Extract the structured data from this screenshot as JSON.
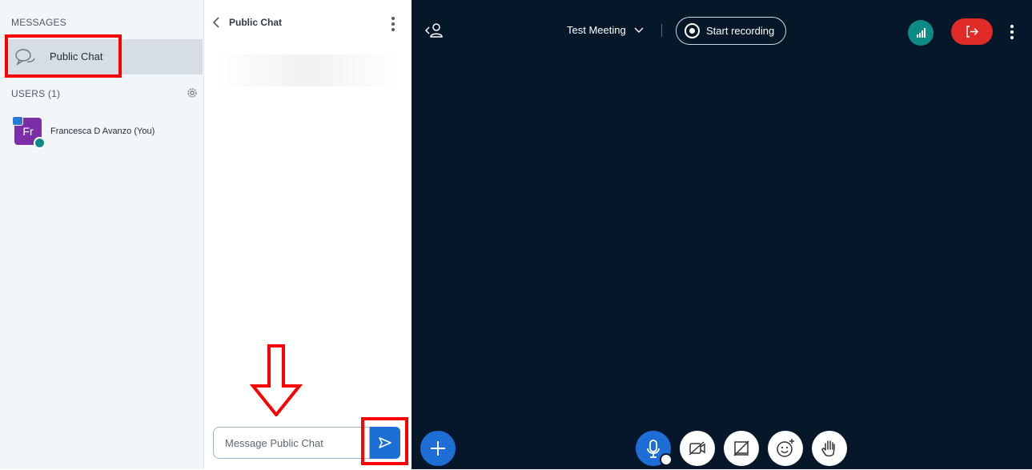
{
  "sidebar": {
    "messages_title": "MESSAGES",
    "public_chat_label": "Public Chat",
    "users_title": "USERS (1)",
    "users": [
      {
        "initials": "Fr",
        "name": "Francesca D Avanzo (You)"
      }
    ]
  },
  "chat": {
    "title": "Public Chat",
    "input_placeholder": "Message Public Chat"
  },
  "top_bar": {
    "meeting_title": "Test Meeting",
    "record_label": "Start recording"
  },
  "icons": {
    "back": "chevron-left-icon",
    "chat": "chat-bubbles-icon",
    "settings": "gear-icon",
    "send": "send-icon",
    "mic": "microphone-icon",
    "camera_off": "camera-off-icon",
    "screenshare_off": "screenshare-off-icon",
    "reactions": "emoji-icon",
    "raise_hand": "hand-icon",
    "connection": "signal-bars-icon",
    "leave": "leave-icon",
    "plus": "plus-icon",
    "more": "kebab-menu-icon"
  },
  "colors": {
    "main_bg": "#06172a",
    "accent_blue": "#1d6fd6",
    "leave_red": "#e12b26",
    "connection_teal": "#0e8a84",
    "avatar_purple": "#7b2ea8",
    "highlight_red": "#ff0000"
  }
}
